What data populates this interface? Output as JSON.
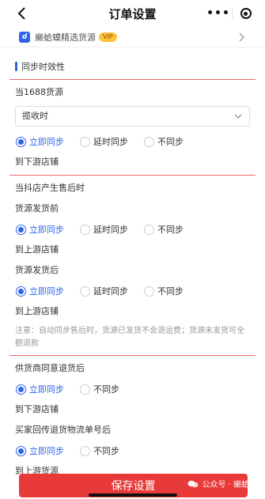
{
  "nav": {
    "title": "订单设置",
    "more": "•••"
  },
  "merchant": {
    "logo_text": "d",
    "name": "癞蛤蟆精选货源",
    "badge": "VIP"
  },
  "section": {
    "title": "同步时效性"
  },
  "block1": {
    "label": "当1688货源",
    "select_value": "揽收时",
    "options": [
      "立即同步",
      "延时同步",
      "不同步"
    ],
    "selected": "立即同步",
    "target": "到下游店铺"
  },
  "block2": {
    "label": "当抖店产生售后时",
    "sub1": {
      "label": "货源发货前",
      "options": [
        "立即同步",
        "延时同步",
        "不同步"
      ],
      "selected": "立即同步",
      "target": "到上游店铺"
    },
    "sub2": {
      "label": "货源发货后",
      "options": [
        "立即同步",
        "延时同步",
        "不同步"
      ],
      "selected": "立即同步",
      "target": "到上游店铺"
    },
    "note": "注意：自动同步售后时，货源已发货不会退运费；货源未发货可全额退款"
  },
  "block3": {
    "label": "供货商同意退货后",
    "options": [
      "立即同步",
      "不同步"
    ],
    "selected": "立即同步",
    "target": "到下游店铺",
    "sub": {
      "label": "买家回传退货物流单号后",
      "options": [
        "立即同步",
        "不同步"
      ],
      "selected": "立即同步",
      "target": "到上游货源"
    }
  },
  "footer": {
    "save_label": "保存设置",
    "watermark": "公众号 · 癞蛤蟆分"
  },
  "colors": {
    "accent": "#2f63e8",
    "danger": "#e93a3a",
    "divider": "#e96a6a"
  }
}
